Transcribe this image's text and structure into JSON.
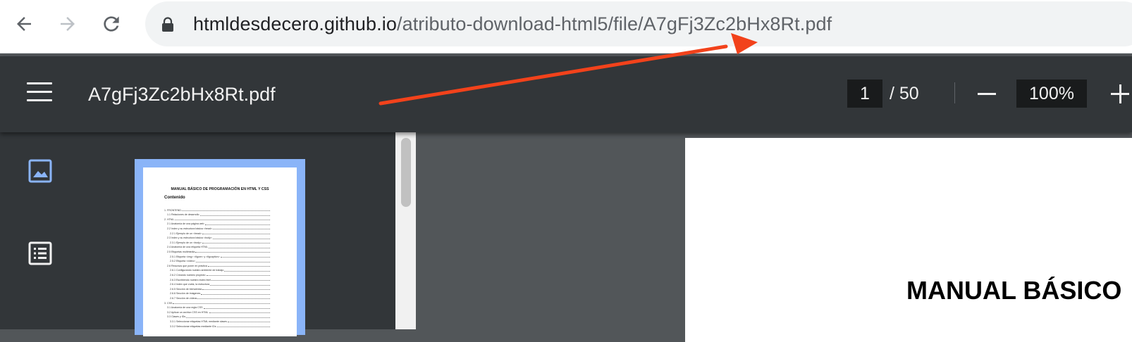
{
  "browser": {
    "url_host": "htmldesdecero.github.io",
    "url_path": "/atributo-download-html5/file/A7gFj3Zc2bHx8Rt.pdf",
    "icons": {
      "back": "arrow-left-icon",
      "forward": "arrow-right-icon",
      "reload": "reload-icon",
      "secure": "lock-icon"
    }
  },
  "pdf_toolbar": {
    "title": "A7gFj3Zc2bHx8Rt.pdf",
    "current_page": "1",
    "page_separator": "/ 50",
    "zoom": "100%",
    "icons": {
      "menu": "hamburger-menu-icon",
      "zoom_out": "minus-icon",
      "zoom_in": "plus-icon"
    }
  },
  "sidebar": {
    "icons": {
      "thumbnails": "image-icon",
      "outline": "list-icon"
    },
    "thumbnail": {
      "title": "MANUAL BÁSICO DE PROGRAMACIÓN EN HTML Y CSS",
      "subtitle": "Contenido",
      "toc": [
        "1. FRONTEND",
        "1.1 Relaciones de desarrollo",
        "2. HTML",
        "2.1 Anatomía de una página web",
        "2.2 Index y su estructura básica <head>",
        "2.2.1 Ejemplo de un <head>",
        "2.3 Index y su estructura básica <body>",
        "2.3.1 Ejemplo de un <body>",
        "2.4 Anatomía de una etiqueta HTML",
        "2.5 Etiquetas multimedia",
        "2.5.1 Etiqueta <img> <figure> y <figcaption>",
        "2.5.2 Etiqueta <video>",
        "2.6 Recursos que poner en práctica",
        "2.6.1 Configurando nuestro ambiente de trabajo",
        "2.6.2 Creando nuestro proyecto",
        "2.6.3 Escribiendo nuestro index.html",
        "2.6.4 Index que vuela, la estructura",
        "2.6.5 Sección de bienvenida",
        "2.6.6 Sección de imágenes",
        "2.6.7 Sección de vídeos",
        "3. CSS",
        "3.1 Anatomía de una regla CSS",
        "3.2 Aplicar un archivo CSS en HTML",
        "3.3 Clases y IDs",
        "3.3.1 Seleccionar etiquetas HTML mediante clases",
        "3.3.2 Seleccionar etiquetas mediante IDs"
      ],
      "toc_indent": [
        0,
        1,
        0,
        1,
        1,
        2,
        1,
        2,
        1,
        1,
        2,
        2,
        1,
        2,
        2,
        2,
        2,
        2,
        2,
        2,
        0,
        1,
        1,
        1,
        2,
        2
      ]
    }
  },
  "main_page": {
    "heading": "MANUAL BÁSICO"
  },
  "annotation": {
    "arrow_color": "#f2421b"
  }
}
